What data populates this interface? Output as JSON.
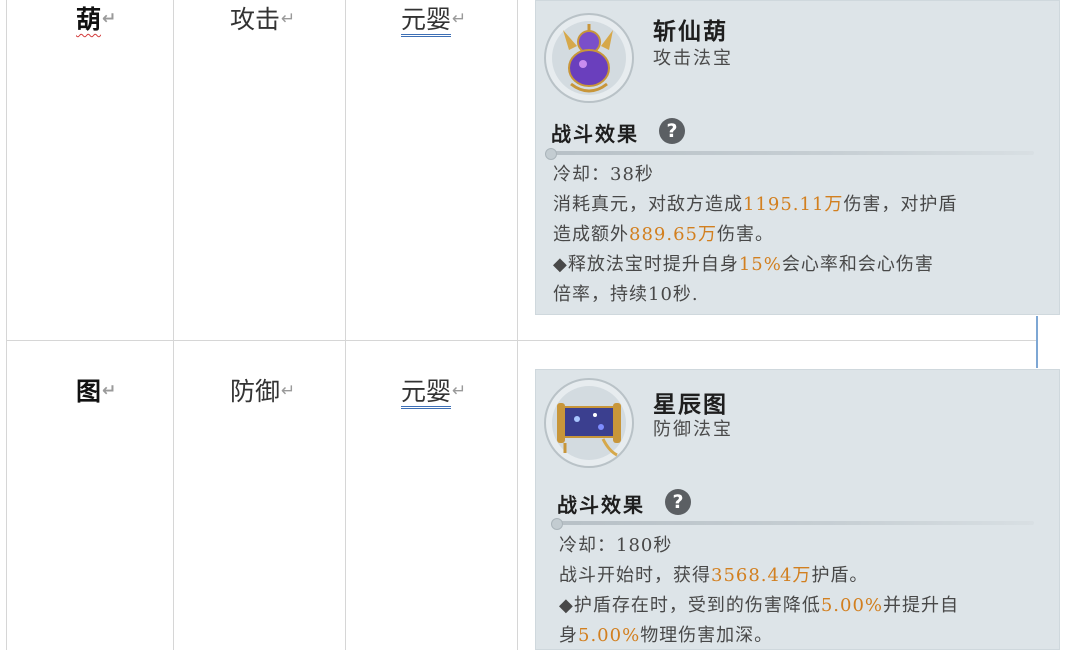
{
  "rows": [
    {
      "name_cell": "葫",
      "kind_cell": "攻击",
      "realm_cell": "元婴",
      "card": {
        "item_name": "斩仙葫",
        "item_type": "攻击法宝",
        "effect_title": "战斗效果",
        "help": "?",
        "lines": [
          [
            {
              "t": "冷却：38秒",
              "h": false
            }
          ],
          [
            {
              "t": "消耗真元，对敌方造成",
              "h": false
            },
            {
              "t": "1195.11万",
              "h": true
            },
            {
              "t": "伤害，对护盾",
              "h": false
            }
          ],
          [
            {
              "t": "造成额外",
              "h": false
            },
            {
              "t": "889.65万",
              "h": true
            },
            {
              "t": "伤害。",
              "h": false
            }
          ],
          [
            {
              "t": "◆释放法宝时提升自身",
              "h": false
            },
            {
              "t": "15%",
              "h": true
            },
            {
              "t": "会心率和会心伤害",
              "h": false
            }
          ],
          [
            {
              "t": "倍率，持续10秒.",
              "h": false
            }
          ]
        ]
      }
    },
    {
      "name_cell": "图",
      "kind_cell": "防御",
      "realm_cell": "元婴",
      "card": {
        "item_name": "星辰图",
        "item_type": "防御法宝",
        "effect_title": "战斗效果",
        "help": "?",
        "lines": [
          [
            {
              "t": "冷却：180秒",
              "h": false
            }
          ],
          [
            {
              "t": "战斗开始时，获得",
              "h": false
            },
            {
              "t": "3568.44万",
              "h": true
            },
            {
              "t": "护盾。",
              "h": false
            }
          ],
          [
            {
              "t": "◆护盾存在时，受到的伤害降低",
              "h": false
            },
            {
              "t": "5.00%",
              "h": true
            },
            {
              "t": "并提升自",
              "h": false
            }
          ],
          [
            {
              "t": "身",
              "h": false
            },
            {
              "t": "5.00%",
              "h": true
            },
            {
              "t": "物理伤害加深。",
              "h": false
            }
          ]
        ]
      }
    }
  ],
  "colors": {
    "highlight": "#d27f1f",
    "card_bg": "#dde4e8",
    "underline": "#3d6fb5"
  },
  "icons": [
    "gourd-treasure-icon",
    "star-scroll-treasure-icon",
    "help-icon"
  ]
}
